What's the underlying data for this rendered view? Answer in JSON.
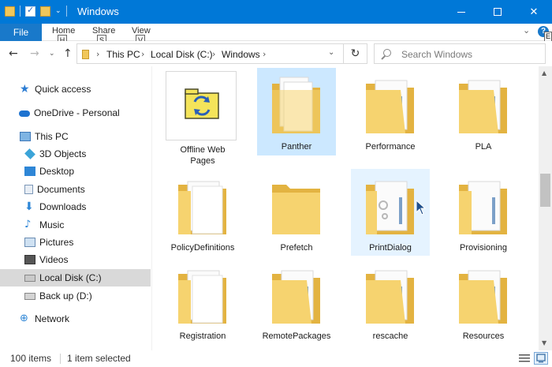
{
  "window": {
    "title": "Windows",
    "controls": {
      "minimize": "minimize-icon",
      "maximize": "maximize-icon",
      "close": "✕"
    }
  },
  "quick_access_toolbar": {
    "caret": "⌄"
  },
  "ribbon": {
    "file_label": "File",
    "tabs": [
      {
        "label": "Home",
        "keytip": "H"
      },
      {
        "label": "Share",
        "keytip": "S"
      },
      {
        "label": "View",
        "keytip": "V"
      }
    ],
    "expand_chevron": "⌄",
    "help": {
      "label": "?",
      "keytip": "E"
    }
  },
  "address": {
    "crumbs": [
      "This PC",
      "Local Disk (C:)",
      "Windows"
    ],
    "separator": "›",
    "dropdown": "⌄",
    "refresh": "↻"
  },
  "nav_buttons": {
    "back": "←",
    "forward": "→",
    "recent": "⌄",
    "up": "↑"
  },
  "search": {
    "placeholder": "Search Windows",
    "value": ""
  },
  "nav_pane": {
    "items": [
      {
        "label": "Quick access",
        "icon": "star-icon",
        "glyph": "★"
      },
      {
        "label": "OneDrive - Personal",
        "icon": "cloud-icon"
      },
      {
        "label": "This PC",
        "icon": "computer-icon"
      },
      {
        "label": "3D Objects",
        "icon": "cube-icon"
      },
      {
        "label": "Desktop",
        "icon": "desktop-icon"
      },
      {
        "label": "Documents",
        "icon": "documents-icon"
      },
      {
        "label": "Downloads",
        "icon": "download-icon",
        "glyph": "⬇"
      },
      {
        "label": "Music",
        "icon": "music-icon",
        "glyph": "♪"
      },
      {
        "label": "Pictures",
        "icon": "pictures-icon"
      },
      {
        "label": "Videos",
        "icon": "videos-icon"
      },
      {
        "label": "Local Disk (C:)",
        "icon": "disk-icon",
        "selected": true
      },
      {
        "label": "Back up (D:)",
        "icon": "disk-icon"
      },
      {
        "label": "Network",
        "icon": "network-icon",
        "glyph": "⊕"
      }
    ]
  },
  "files": [
    {
      "name": "Offline Web Pages",
      "line1": "Offline Web",
      "line2": "Pages",
      "type": "special"
    },
    {
      "name": "Panther",
      "type": "folder",
      "state": "selected"
    },
    {
      "name": "Performance",
      "type": "folder"
    },
    {
      "name": "PLA",
      "type": "folder"
    },
    {
      "name": "PolicyDefinitions",
      "type": "folder"
    },
    {
      "name": "Prefetch",
      "type": "folder"
    },
    {
      "name": "PrintDialog",
      "type": "folder",
      "state": "hover"
    },
    {
      "name": "Provisioning",
      "type": "folder"
    },
    {
      "name": "Registration",
      "type": "folder"
    },
    {
      "name": "RemotePackages",
      "type": "folder"
    },
    {
      "name": "rescache",
      "type": "folder"
    },
    {
      "name": "Resources",
      "type": "folder"
    }
  ],
  "scrollbar": {
    "up": "▲",
    "down": "▼"
  },
  "status": {
    "item_count": "100 items",
    "selection": "1 item selected"
  },
  "colors": {
    "titlebar": "#0078d7",
    "selection": "#cce8ff",
    "hover": "#e5f3ff",
    "folder": "#f1c75b"
  }
}
